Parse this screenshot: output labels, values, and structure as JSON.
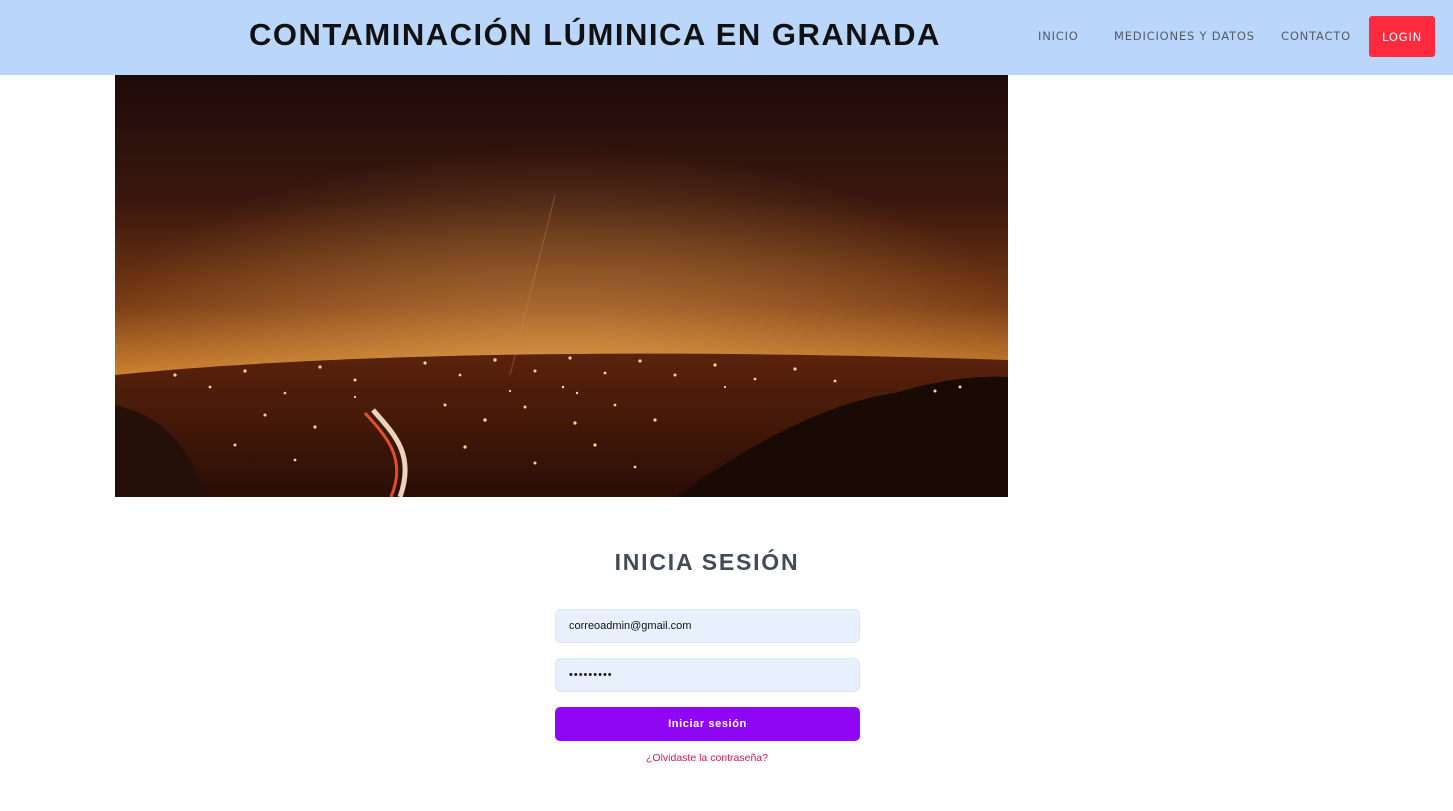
{
  "header": {
    "site_title": "CONTAMINACIÓN LÚMINICA EN GRANADA",
    "nav": {
      "inicio": "INICIO",
      "mediciones": "MEDICIONES Y DATOS",
      "contacto": "CONTACTO",
      "login": "LOGIN"
    }
  },
  "hero": {
    "image_subject": "city-lights-night-photo"
  },
  "login_form": {
    "title": "INICIA SESIÓN",
    "email_value": "correoadmin@gmail.com",
    "password_value": "•••••••••",
    "submit_label": "Iniciar sesión",
    "forgot_label": "¿Olvidaste la contraseña?"
  },
  "colors": {
    "header_bg": "#bad7fb",
    "login_button": "#ff2a3d",
    "submit_button": "#8f07f4",
    "forgot_link": "#d4145a"
  }
}
